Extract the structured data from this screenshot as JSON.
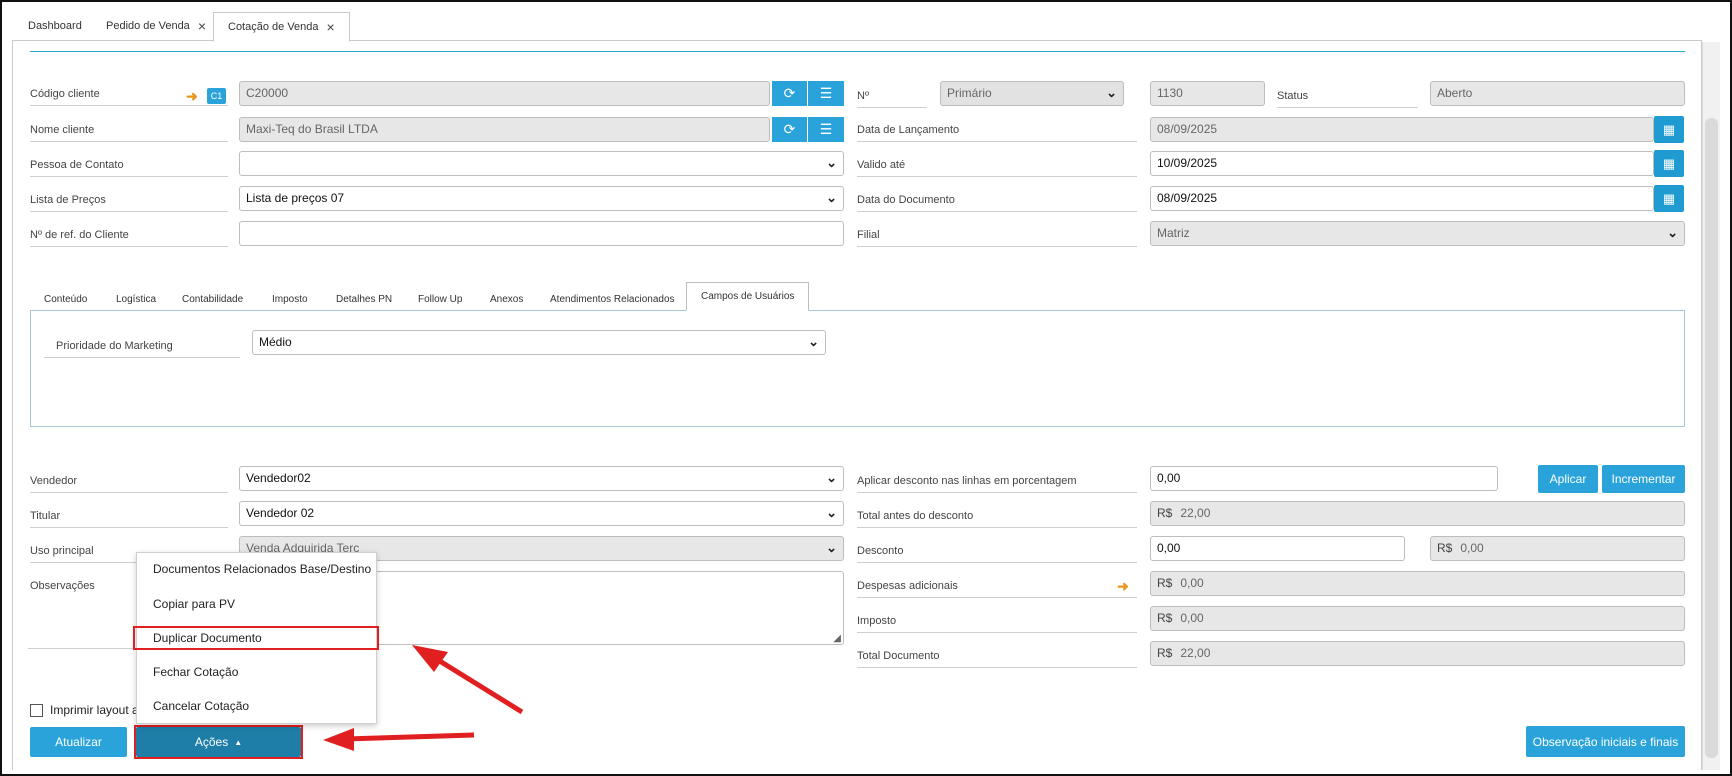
{
  "tabs": [
    {
      "label": "Dashboard"
    },
    {
      "label": "Pedido de Venda",
      "close": "×"
    },
    {
      "label": "Cotação de Venda",
      "close": "×"
    }
  ],
  "header": {
    "codigo_cliente_label": "Código cliente",
    "codigo_cliente_badge": "C1",
    "codigo_cliente_value": "C20000",
    "nome_cliente_label": "Nome cliente",
    "nome_cliente_value": "Maxi-Teq do Brasil LTDA",
    "pessoa_contato_label": "Pessoa de Contato",
    "pessoa_contato_value": "",
    "lista_precos_label": "Lista de Preços",
    "lista_precos_value": "Lista de preços 07",
    "ref_cliente_label": "Nº de ref. do Cliente",
    "ref_cliente_value": "",
    "numero_label": "Nº",
    "numero_serie": "Primário",
    "numero_value": "1130",
    "status_label": "Status",
    "status_value": "Aberto",
    "data_lancamento_label": "Data de Lançamento",
    "data_lancamento_value": "08/09/2025",
    "valido_ate_label": "Valido até",
    "valido_ate_value": "10/09/2025",
    "data_documento_label": "Data do Documento",
    "data_documento_value": "08/09/2025",
    "filial_label": "Filial",
    "filial_value": "Matriz"
  },
  "subtabs": [
    {
      "label": "Conteúdo"
    },
    {
      "label": "Logística"
    },
    {
      "label": "Contabilidade"
    },
    {
      "label": "Imposto"
    },
    {
      "label": "Detalhes PN"
    },
    {
      "label": "Follow Up"
    },
    {
      "label": "Anexos"
    },
    {
      "label": "Atendimentos Relacionados"
    },
    {
      "label": "Campos de Usuários"
    }
  ],
  "campos_usuarios": {
    "prioridade_label": "Prioridade do Marketing",
    "prioridade_value": "Médio"
  },
  "footer_left": {
    "vendedor_label": "Vendedor",
    "vendedor_value": "Vendedor02",
    "titular_label": "Titular",
    "titular_value": "Vendedor 02",
    "uso_label": "Uso principal",
    "uso_value": "Venda Adquirida Terc",
    "observacoes_label": "Observações",
    "imprimir_label": "Imprimir layout a"
  },
  "footer_right": {
    "desconto_pct_label": "Aplicar desconto nas linhas em porcentagem",
    "desconto_pct_value": "0,00",
    "aplicar_label": "Aplicar",
    "incrementar_label": "Incrementar",
    "total_antes_label": "Total antes do desconto",
    "total_antes_value": "22,00",
    "desconto_label": "Desconto",
    "desconto_value": "0,00",
    "desconto_rs_value": "0,00",
    "despesas_label": "Despesas adicionais",
    "despesas_value": "0,00",
    "imposto_label": "Imposto",
    "imposto_value": "0,00",
    "total_doc_label": "Total Documento",
    "total_doc_value": "22,00",
    "currency": "R$"
  },
  "actions": {
    "atualizar_label": "Atualizar",
    "acoes_label": "Ações",
    "observacao_label": "Observação iniciais e finais"
  },
  "menu": {
    "items": [
      {
        "label": "Documentos Relacionados Base/Destino"
      },
      {
        "label": "Copiar para PV"
      },
      {
        "label": "Duplicar Documento"
      },
      {
        "label": "Fechar Cotação"
      },
      {
        "label": "Cancelar Cotação"
      }
    ]
  },
  "colors": {
    "accent": "#29a3d9",
    "highlight": "#e02020",
    "orange": "#e8971f"
  }
}
